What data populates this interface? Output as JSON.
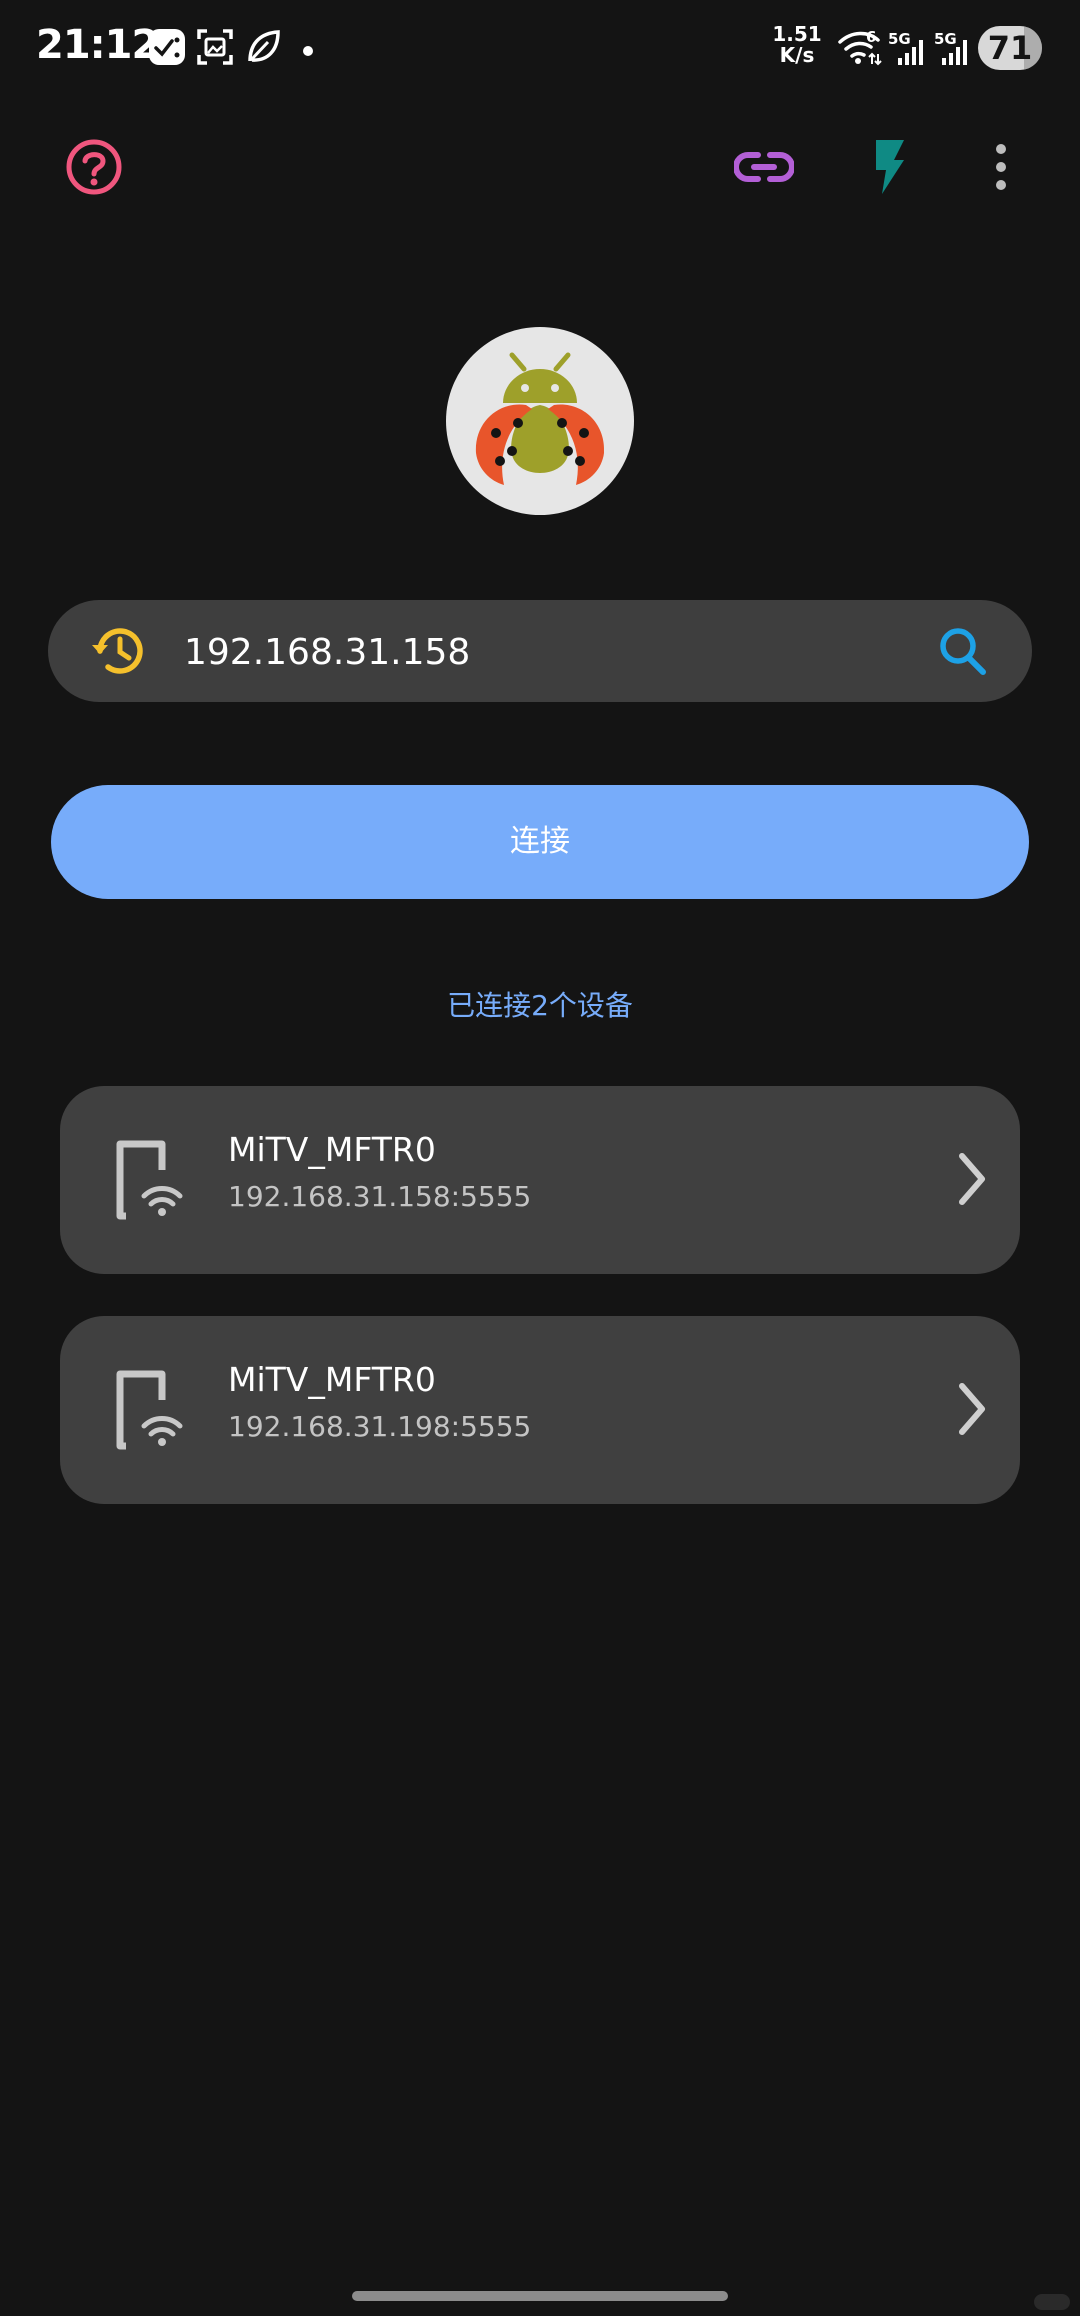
{
  "status_bar": {
    "time": "21:12",
    "net_speed_value": "1.51",
    "net_speed_unit": "K/s",
    "wifi_badge": "6",
    "sim1_label": "5G",
    "sim2_label": "5G",
    "battery": "71",
    "icons": [
      "check-notification-icon",
      "screenshot-icon",
      "leaf-icon",
      "dot-icon",
      "wifi-icon",
      "signal-icon",
      "signal-icon",
      "battery-icon"
    ]
  },
  "appbar": {
    "icons": [
      "help-icon",
      "link-icon",
      "flash-icon",
      "more-vert-icon"
    ],
    "colors": {
      "help": "#f0567e",
      "link": "#b35fd6",
      "flash": "#0f8a84",
      "more": "#bdbdbd"
    }
  },
  "logo": {
    "icon": "ladybug-android-icon"
  },
  "search": {
    "value": "192.168.31.158",
    "history_icon": "history-icon",
    "search_icon": "search-icon",
    "history_color": "#f5c02c",
    "search_color": "#1da1e6"
  },
  "connect_button": {
    "label": "连接",
    "color": "#77acfa"
  },
  "connected_count": "已连接2个设备",
  "devices": [
    {
      "name": "MiTV_MFTR0",
      "address": "192.168.31.158:5555"
    },
    {
      "name": "MiTV_MFTR0",
      "address": "192.168.31.198:5555"
    }
  ]
}
